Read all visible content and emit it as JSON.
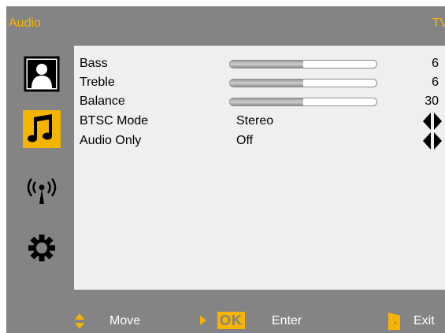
{
  "title": {
    "left": "Audio",
    "right": "TV"
  },
  "sidebar": {
    "items": [
      {
        "icon": "picture-icon",
        "active": false
      },
      {
        "icon": "music-note-icon",
        "active": true
      },
      {
        "icon": "antenna-signal-icon",
        "active": false
      },
      {
        "icon": "gear-icon",
        "active": false
      }
    ]
  },
  "menu": {
    "bass": {
      "label": "Bass",
      "value": "6",
      "level": 0.5
    },
    "treble": {
      "label": "Treble",
      "value": "6",
      "level": 0.5
    },
    "balance": {
      "label": "Balance",
      "value": "30",
      "level": 0.5
    },
    "btsc": {
      "label": "BTSC Mode",
      "value": "Stereo"
    },
    "audio_only": {
      "label": "Audio Only",
      "value": "Off"
    }
  },
  "footer": {
    "move": "Move",
    "ok": "OK",
    "enter": "Enter",
    "exit": "Exit"
  },
  "colors": {
    "accent": "#f5b400",
    "background": "#848484",
    "panel": "#efefef"
  }
}
